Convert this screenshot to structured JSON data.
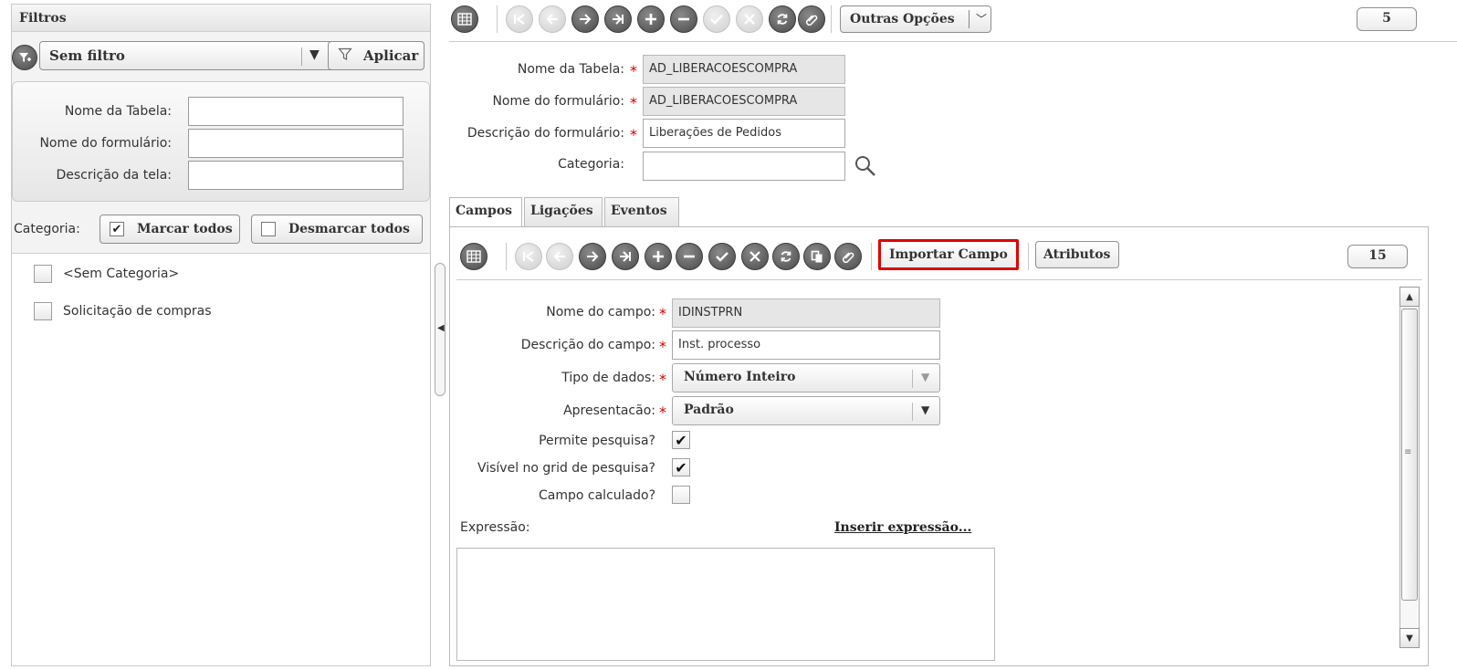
{
  "left_panel": {
    "title": "Filtros",
    "filter_select": {
      "value": "Sem filtro",
      "arrow": "▼"
    },
    "apply_label": "Aplicar",
    "fields": {
      "table_name_label": "Nome da Tabela:",
      "form_name_label": "Nome do formulário:",
      "screen_desc_label": "Descrição da tela:"
    },
    "category_label": "Categoria:",
    "mark_all_label": "Marcar todos",
    "unmark_all_label": "Desmarcar todos",
    "categories": [
      {
        "label": "<Sem Categoria>",
        "checked": false
      },
      {
        "label": "Solicitação de compras",
        "checked": false
      }
    ]
  },
  "toolbar": {
    "other_options_label": "Outras Opções",
    "record_count": "5"
  },
  "form": {
    "table_name_label": "Nome da Tabela:",
    "table_name_value": "AD_LIBERACOESCOMPRA",
    "form_name_label": "Nome do formulário:",
    "form_name_value": "AD_LIBERACOESCOMPRA",
    "form_desc_label": "Descrição do formulário:",
    "form_desc_value": "Liberações de Pedidos",
    "category_label": "Categoria:",
    "category_value": ""
  },
  "tabs": [
    {
      "label": "Campos",
      "active": true
    },
    {
      "label": "Ligações",
      "active": false
    },
    {
      "label": "Eventos",
      "active": false
    }
  ],
  "fields_toolbar": {
    "import_label": "Importar Campo",
    "attributes_label": "Atributos",
    "record_count": "15"
  },
  "field_form": {
    "field_name_label": "Nome do campo:",
    "field_name_value": "IDINSTPRN",
    "field_desc_label": "Descrição do campo:",
    "field_desc_value": "Inst. processo",
    "data_type_label": "Tipo de dados:",
    "data_type_value": "Número Inteiro",
    "presentation_label": "Apresentacão:",
    "presentation_value": "Padrão",
    "allow_search_label": "Permite pesquisa?",
    "allow_search_checked": true,
    "visible_grid_label": "Visível no grid de pesquisa?",
    "visible_grid_checked": true,
    "calculated_label": "Campo calculado?",
    "calculated_checked": false,
    "expression_label": "Expressão:",
    "insert_expression_label": "Inserir expressão...",
    "required_mark": "*"
  },
  "colors": {
    "required": "#d00000",
    "highlight": "#e00000"
  }
}
